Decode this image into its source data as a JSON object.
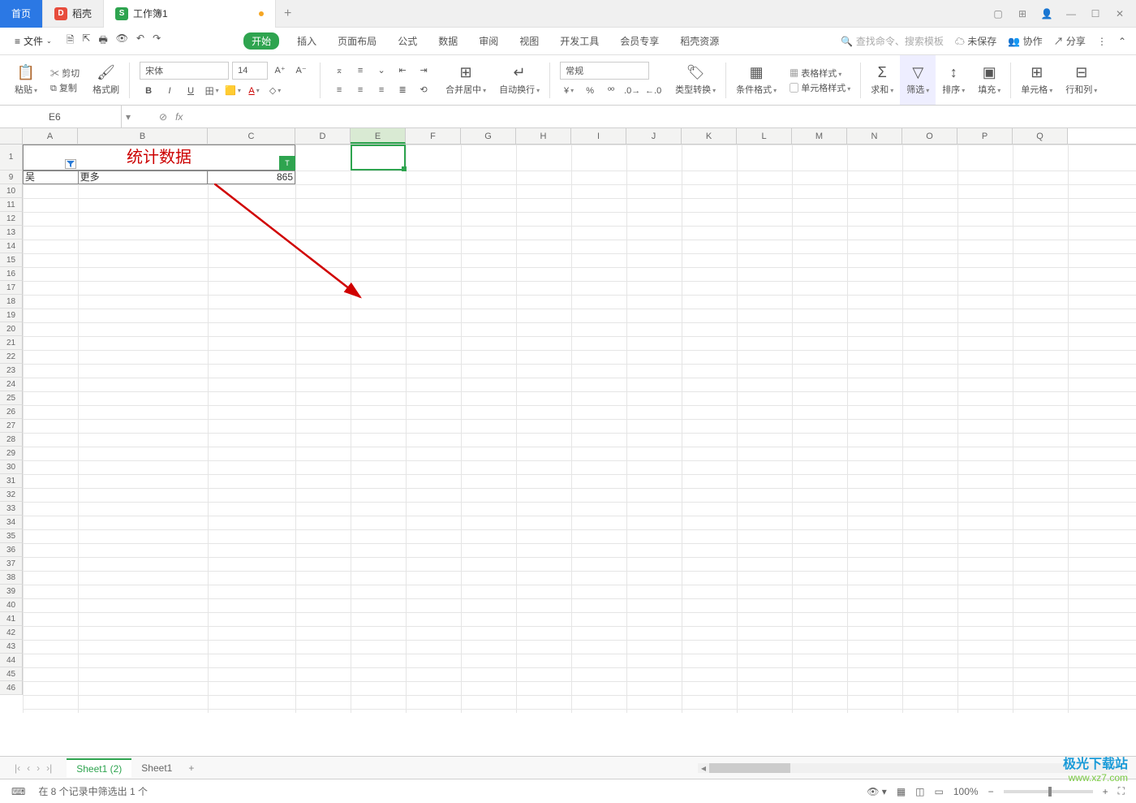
{
  "title_tabs": {
    "home": "首页",
    "daoke": "稻壳",
    "workbook": "工作簿1"
  },
  "menu": {
    "file": "文件"
  },
  "tabs": {
    "start": "开始",
    "insert": "插入",
    "layout": "页面布局",
    "formula": "公式",
    "data": "数据",
    "review": "审阅",
    "view": "视图",
    "dev": "开发工具",
    "member": "会员专享",
    "daoke": "稻壳资源"
  },
  "search_placeholder": "查找命令、搜索模板",
  "right_actions": {
    "unsaved": "未保存",
    "collab": "协作",
    "share": "分享"
  },
  "ribbon": {
    "paste": "粘贴",
    "cut": "剪切",
    "copy": "复制",
    "format_painter": "格式刷",
    "font_name": "宋体",
    "font_size": "14",
    "merge": "合并居中",
    "wrap": "自动换行",
    "number_format": "常规",
    "type_convert": "类型转换",
    "cond_format": "条件格式",
    "table_style": "表格样式",
    "cell_style": "单元格样式",
    "sum": "求和",
    "filter": "筛选",
    "sort": "排序",
    "fill": "填充",
    "cell": "单元格",
    "rowcol": "行和列"
  },
  "namebox": "E6",
  "sheet_data": {
    "title": "统计数据",
    "a9": "吴",
    "b9": "更多",
    "c9": "865"
  },
  "columns": [
    "A",
    "B",
    "C",
    "D",
    "E",
    "F",
    "G",
    "H",
    "I",
    "J",
    "K",
    "L",
    "M",
    "N",
    "O",
    "P",
    "Q"
  ],
  "rows_shown": [
    "1",
    "9",
    "10",
    "11",
    "12",
    "13",
    "14",
    "15",
    "16",
    "17",
    "18",
    "19",
    "20",
    "21",
    "22",
    "23",
    "24",
    "25",
    "26",
    "27",
    "28",
    "29",
    "30",
    "31",
    "32",
    "33",
    "34",
    "35",
    "36",
    "37",
    "38",
    "39",
    "40",
    "41",
    "42",
    "43",
    "44",
    "45",
    "46"
  ],
  "sheets": {
    "s1": "Sheet1 (2)",
    "s2": "Sheet1"
  },
  "status": {
    "filter_info": "在 8 个记录中筛选出 1 个",
    "zoom": "100%"
  },
  "watermark": {
    "line1": "极光下载站",
    "line2": "www.xz7.com"
  }
}
